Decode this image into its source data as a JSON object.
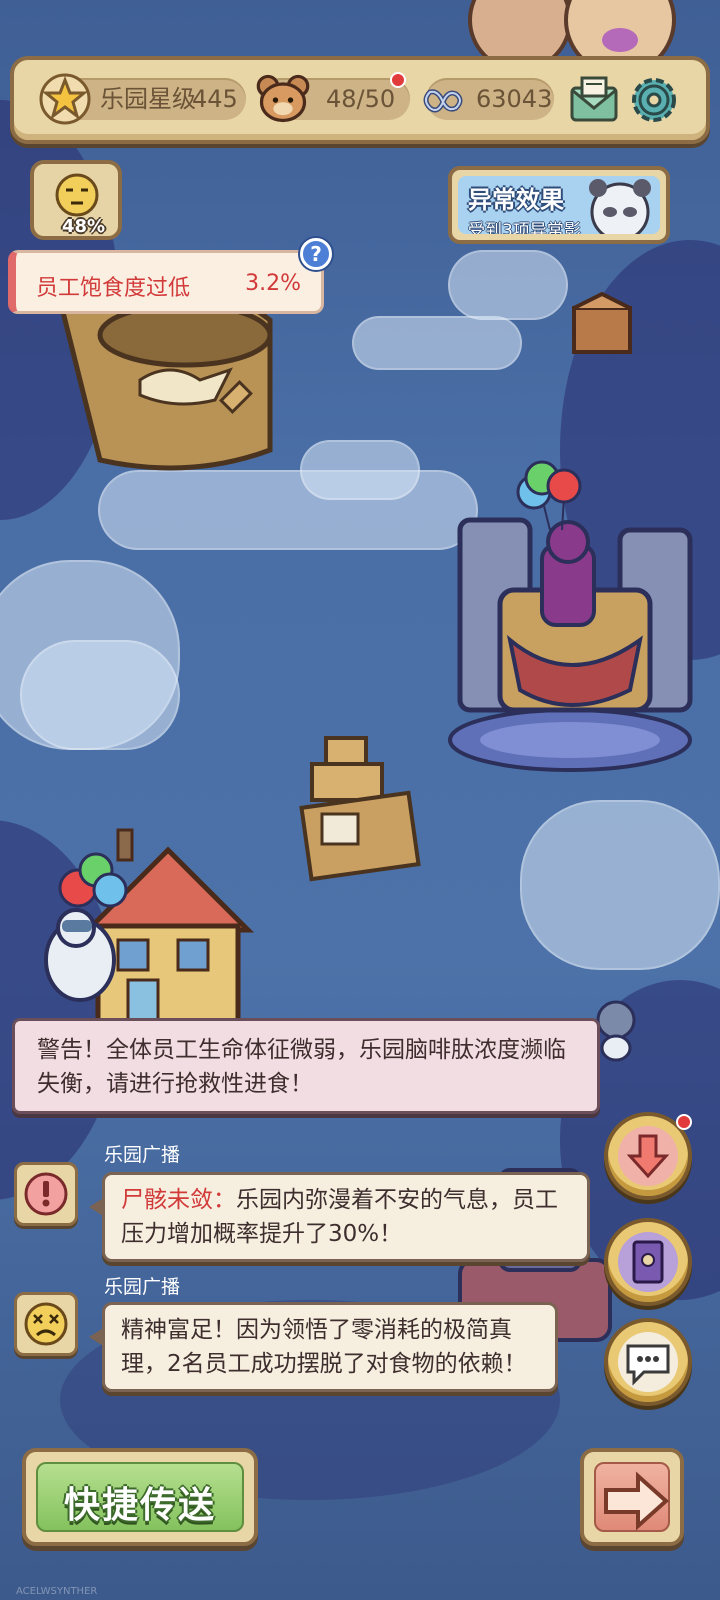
{
  "topbar": {
    "park_star_label": "乐园星级",
    "park_star_value": "445",
    "staff_count": "48/50",
    "currency_value": "63043"
  },
  "status": {
    "mood_percent": "48%",
    "hunger_label": "员工饱食度过低",
    "hunger_value": "3.2%",
    "help_label": "?"
  },
  "anomaly": {
    "title": "异常效果",
    "subtitle": "受到3项异常影"
  },
  "warning": {
    "text": "警告！全体员工生命体征微弱，乐园脑啡肽浓度濒临失衡，请进行抢救性进食！"
  },
  "broadcasts": [
    {
      "sender": "乐园广播",
      "highlight": "尸骸未敛：",
      "text": "乐园内弥漫着不安的气息，员工压力增加概率提升了30%！"
    },
    {
      "sender": "乐园广播",
      "highlight": "",
      "text": "精神富足！因为领悟了零消耗的极简真理，2名员工成功摆脱了对食物的依赖！"
    }
  ],
  "bottom": {
    "quick_teleport_label": "快捷传送"
  },
  "watermark": "ACELWSYNTHER",
  "colors": {
    "background": "#4a6ea6",
    "panel": "#e9d6a6",
    "panel_border": "#8c6c44",
    "alert_red": "#d23a3a",
    "quick_green": "#84c25e"
  }
}
